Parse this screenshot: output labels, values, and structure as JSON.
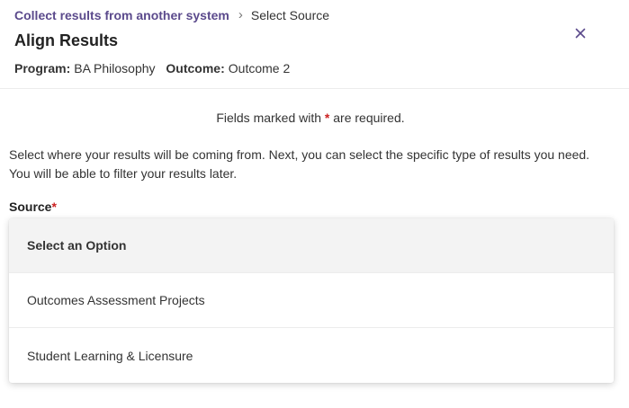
{
  "breadcrumb": {
    "parent": "Collect results from another system",
    "separator": "›",
    "current": "Select Source"
  },
  "page_title": "Align Results",
  "meta": {
    "program_label": "Program:",
    "program_value": "BA Philosophy",
    "outcome_label": "Outcome:",
    "outcome_value": "Outcome 2"
  },
  "required_note": {
    "prefix": "Fields marked with",
    "star": "*",
    "suffix": "are required."
  },
  "description": "Select where your results will be coming from. Next, you can select the specific type of results you need. You will be able to filter your results later.",
  "source": {
    "label": "Source",
    "star": "*",
    "options": [
      "Select an Option",
      "Outcomes Assessment Projects",
      "Student Learning & Licensure"
    ]
  },
  "colors": {
    "link": "#5b4a8c",
    "required": "#cc2222",
    "selected_option_bg": "#f3f3f3"
  },
  "icons": {
    "close": "close-icon",
    "separator": "chevron-right-icon"
  }
}
